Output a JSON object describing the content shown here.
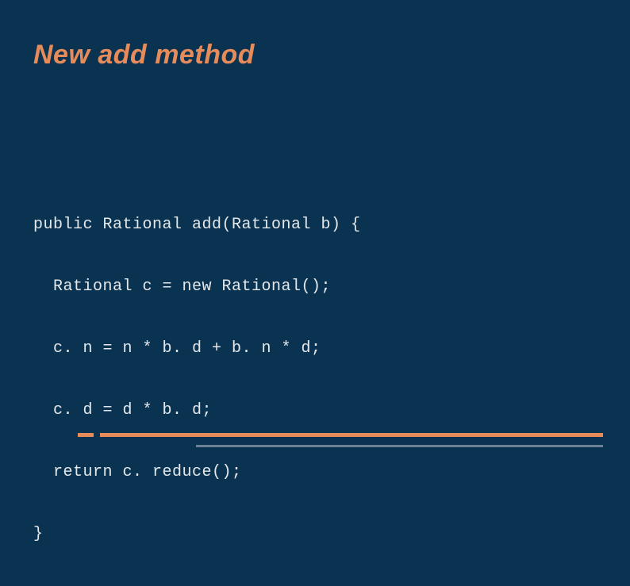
{
  "slide": {
    "title": "New add method",
    "code_lines": [
      "public Rational add(Rational b) {",
      "  Rational c = new Rational();",
      "  c. n = n * b. d + b. n * d;",
      "  c. d = d * b. d;",
      "  return c. reduce();",
      "}"
    ]
  }
}
